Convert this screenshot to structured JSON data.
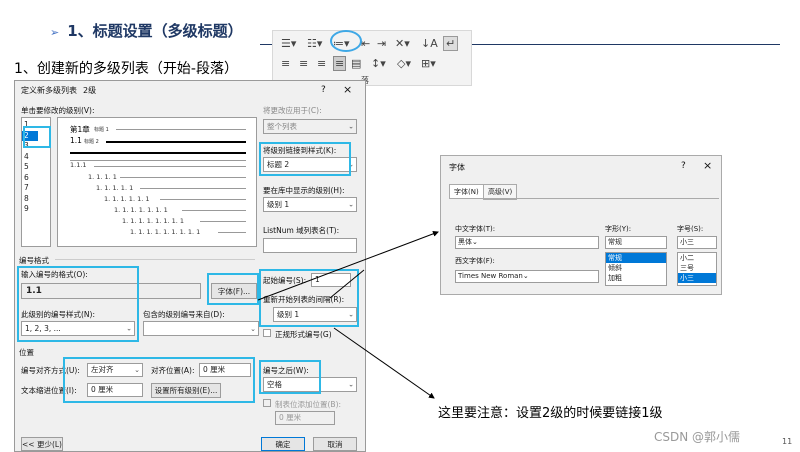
{
  "slide": {
    "title": "1、标题设置（多级标题）",
    "step": "1、创建新的多级列表（开始-段落）",
    "note": "这里要注意：设置2级的时候要链接1级",
    "watermark": "CSDN @郭小儒",
    "page_number": "11"
  },
  "ribbon": {
    "group_label": "落"
  },
  "dialog": {
    "title": "定义新多级列表",
    "annotation": "2级",
    "help": "?",
    "close": "×",
    "click_level_label": "单击要修改的级别(V):",
    "levels": [
      "1",
      "2",
      "3",
      "4",
      "5",
      "6",
      "7",
      "8",
      "9"
    ],
    "apply_to_label": "将更改应用于(C):",
    "apply_to_value": "整个列表",
    "link_style_label": "将级别链接到样式(K):",
    "link_style_value": "标题 2",
    "gallery_level_label": "要在库中显示的级别(H):",
    "gallery_level_value": "级别 1",
    "listnum_label": "ListNum 域列表名(T):",
    "preview": {
      "row1": "第1章",
      "row1_tag": "标题 1",
      "row2": "1.1",
      "row2_tag": "标题 2",
      "row3": "1.1.1",
      "rows": [
        "1. 1. 1. 1",
        "1. 1. 1. 1. 1",
        "1. 1. 1. 1. 1. 1",
        "1. 1. 1. 1. 1. 1. 1",
        "1. 1. 1. 1. 1. 1. 1. 1",
        "1. 1. 1. 1. 1. 1. 1. 1. 1"
      ]
    },
    "section_format": "编号格式",
    "enter_format_label": "输入编号的格式(O):",
    "format_value": "1.1",
    "font_button": "字体(F)...",
    "style_label": "此级别的编号样式(N):",
    "style_value": "1, 2, 3, ...",
    "include_label": "包含的级别编号来自(D):",
    "start_at_label": "起始编号(S):",
    "start_at_value": "1",
    "restart_label": "重新开始列表的间隔(R):",
    "restart_value": "级别 1",
    "legal_label": "正规形式编号(G)",
    "section_position": "位置",
    "align_label": "编号对齐方式(U):",
    "align_value": "左对齐",
    "align_at_label": "对齐位置(A):",
    "align_at_value": "0 厘米",
    "indent_label": "文本缩进位置(I):",
    "indent_value": "0 厘米",
    "set_all_button": "设置所有级别(E)...",
    "follow_label": "编号之后(W):",
    "follow_value": "空格",
    "tab_stop_label": "制表位添加位置(B):",
    "tab_stop_value": "0 厘米",
    "less_button": "<< 更少(L)",
    "ok_button": "确定",
    "cancel_button": "取消"
  },
  "font_dialog": {
    "title": "字体",
    "help": "?",
    "close": "×",
    "tab_font": "字体(N)",
    "tab_advanced": "高级(V)",
    "cn_font_label": "中文字体(T):",
    "cn_font_value": "黑体",
    "style_label": "字形(Y):",
    "style_value": "常规",
    "style_options": [
      "常规",
      "倾斜",
      "加粗"
    ],
    "size_label": "字号(S):",
    "size_value": "小三",
    "size_options": [
      "小二",
      "三号",
      "小三"
    ],
    "western_label": "西文字体(F):",
    "western_value": "Times New Roman"
  }
}
